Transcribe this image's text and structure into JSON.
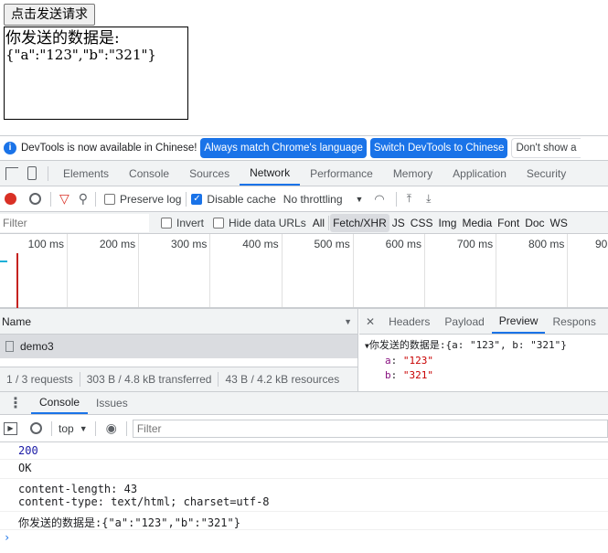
{
  "page": {
    "button_label": "点击发送请求",
    "result_label": "你发送的数据是:",
    "result_value": "{\"a\":\"123\",\"b\":\"321\"}"
  },
  "infobar": {
    "message": "DevTools is now available in Chinese!",
    "btn1": "Always match Chrome's language",
    "btn2": "Switch DevTools to Chinese",
    "btn3": "Don't show a"
  },
  "tabs": [
    "Elements",
    "Console",
    "Sources",
    "Network",
    "Performance",
    "Memory",
    "Application",
    "Security"
  ],
  "toolbar": {
    "preserve_log": "Preserve log",
    "disable_cache": "Disable cache",
    "throttling": "No throttling"
  },
  "filterbar": {
    "placeholder": "Filter",
    "invert": "Invert",
    "hide_data_urls": "Hide data URLs",
    "types": [
      "All",
      "Fetch/XHR",
      "JS",
      "CSS",
      "Img",
      "Media",
      "Font",
      "Doc",
      "WS"
    ]
  },
  "timeline": {
    "ticks": [
      "100 ms",
      "200 ms",
      "300 ms",
      "400 ms",
      "500 ms",
      "600 ms",
      "700 ms",
      "800 ms",
      "90"
    ]
  },
  "requests": {
    "header": "Name",
    "rows": [
      "demo3"
    ],
    "status": [
      "1 / 3 requests",
      "303 B / 4.8 kB transferred",
      "43 B / 4.2 kB resources"
    ]
  },
  "detail": {
    "tabs": [
      "Headers",
      "Payload",
      "Preview",
      "Respons"
    ],
    "summary": "你发送的数据是:{a: \"123\", b: \"321\"}",
    "props": [
      {
        "k": "a",
        "v": "\"123\""
      },
      {
        "k": "b",
        "v": "\"321\""
      }
    ]
  },
  "drawer": {
    "tabs": [
      "Console",
      "Issues"
    ],
    "context": "top",
    "filter_placeholder": "Filter"
  },
  "console": {
    "lines": [
      "200",
      "OK",
      "content-length: 43",
      "content-type: text/html; charset=utf-8",
      "你发送的数据是:{\"a\":\"123\",\"b\":\"321\"}"
    ]
  }
}
